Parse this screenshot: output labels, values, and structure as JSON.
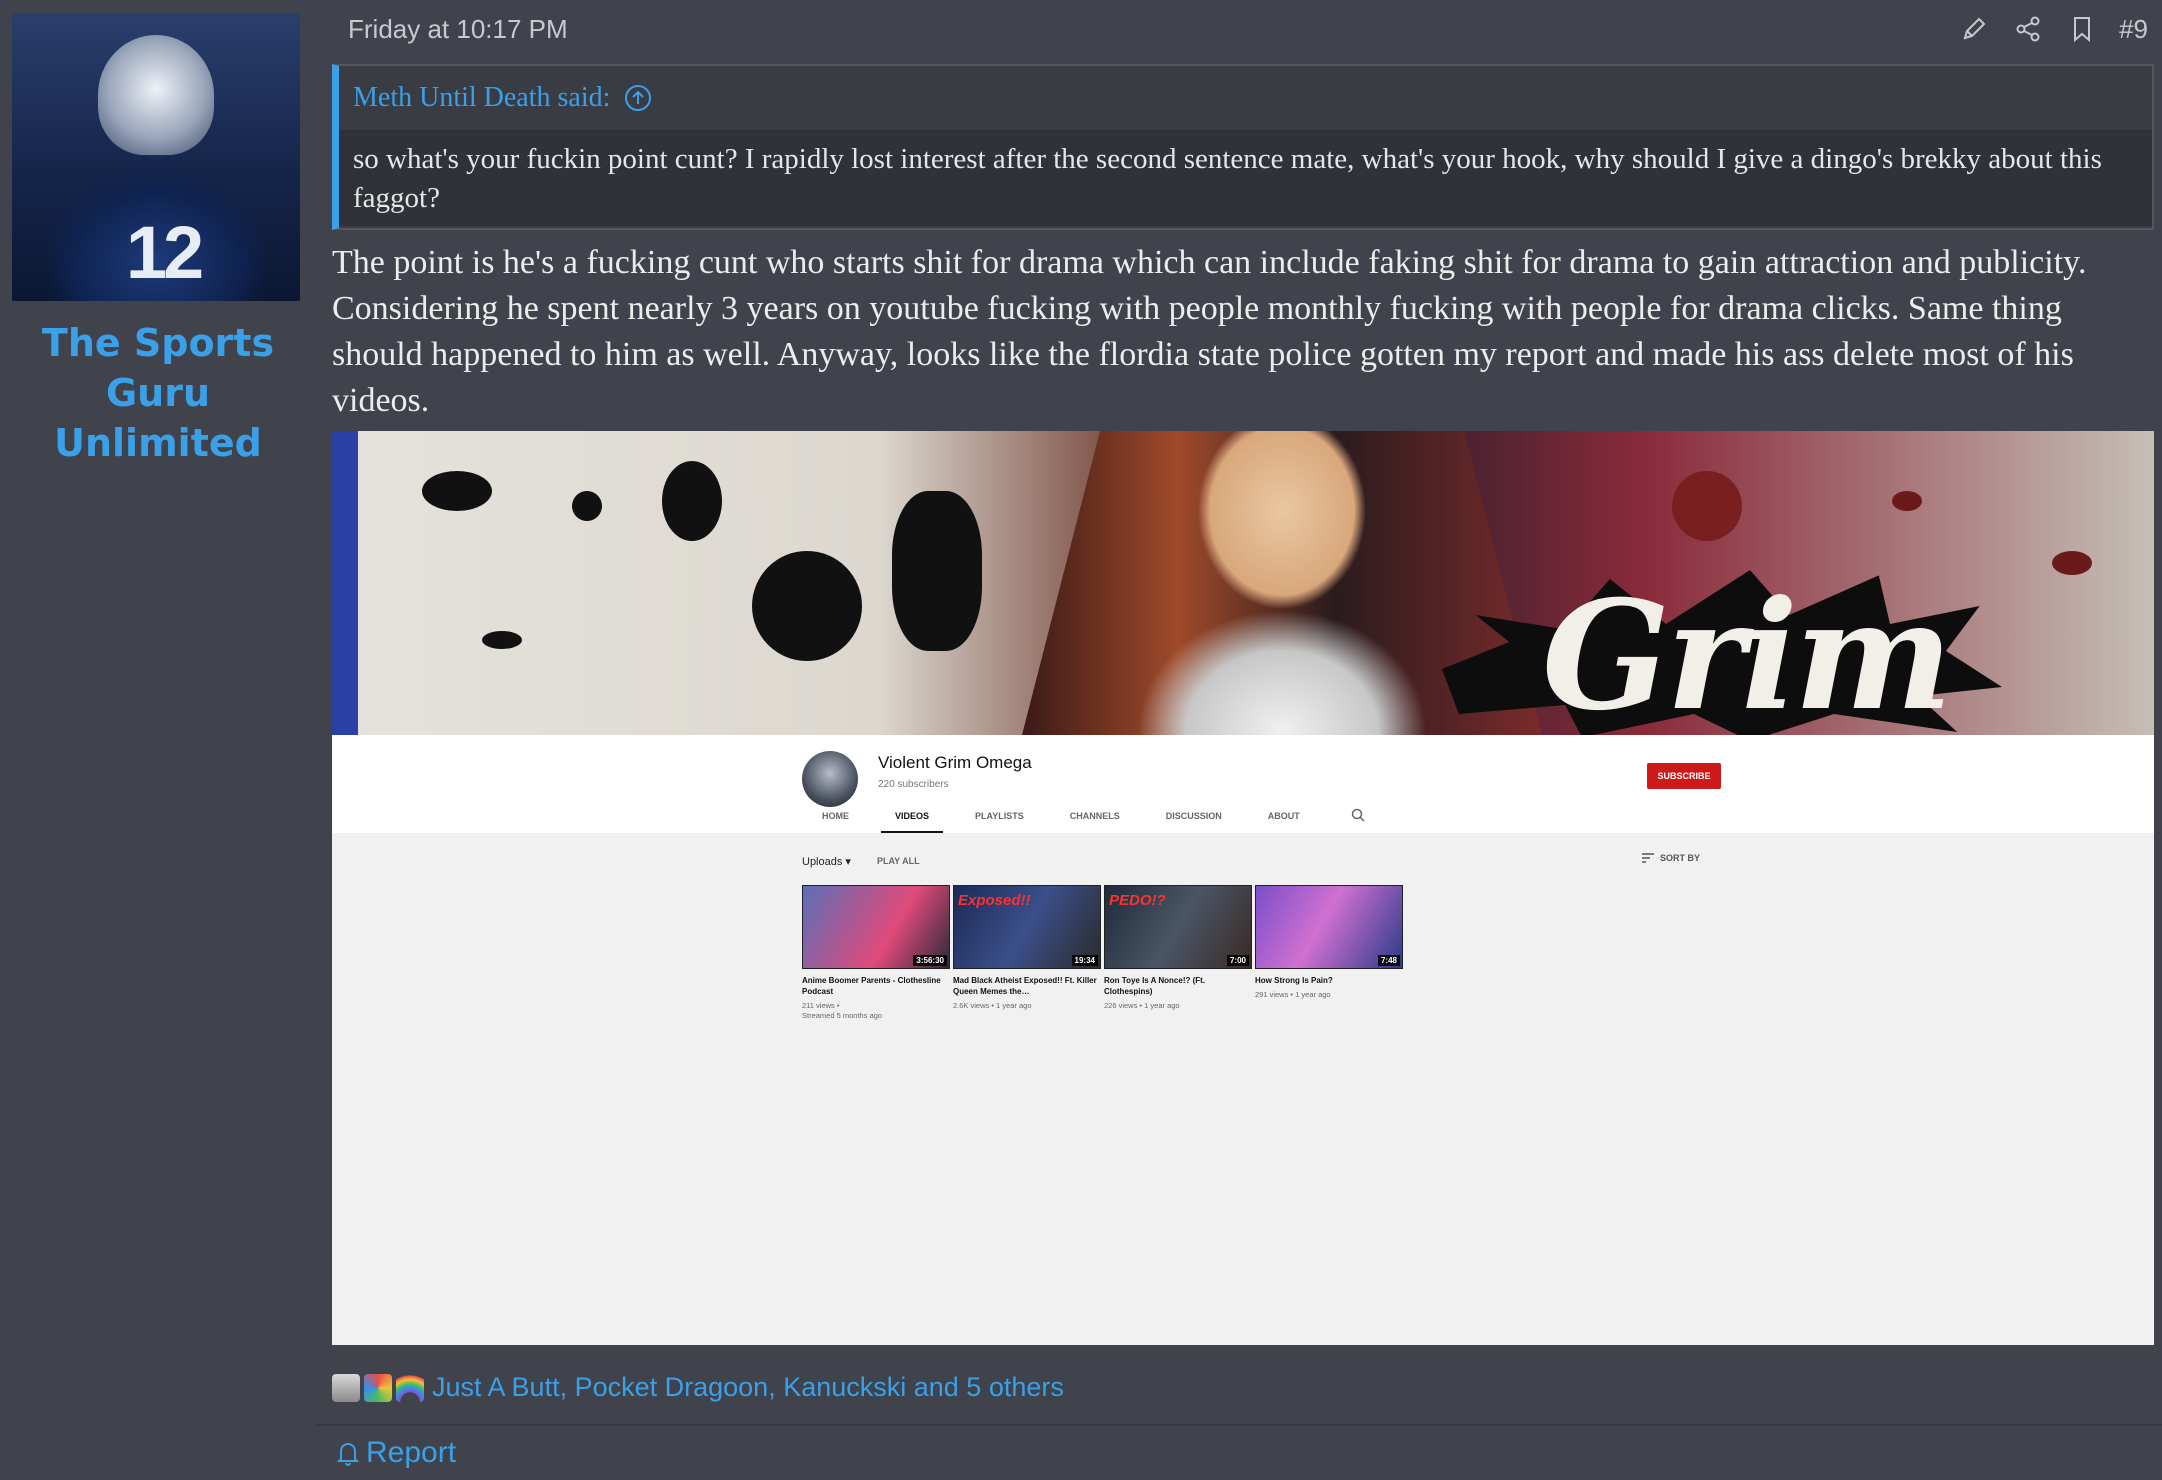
{
  "user": {
    "name": "The Sports Guru Unlimited",
    "avatar_number": "12"
  },
  "post": {
    "date": "Friday at 10:17 PM",
    "number": "#9",
    "actions": [
      "edit-icon",
      "share-icon",
      "bookmark-icon"
    ],
    "quote": {
      "author": "Meth Until Death said:",
      "text": "so what's your fuckin point cunt? I rapidly lost interest after the second sentence mate, what's your hook, why should I give a dingo's brekky about this faggot?"
    },
    "body": "The point is he's a fucking cunt who starts shit for drama which can include faking shit for drama to gain attraction and publicity. Considering he spent nearly 3 years on youtube fucking with people monthly fucking with people for drama clicks. Same thing should happened to him as well. Anyway, looks like the flordia state police gotten my report and made his ass delete most of his videos."
  },
  "embed": {
    "banner_text": "Grim",
    "channel": {
      "name": "Violent Grim Omega",
      "subscribers": "220 subscribers",
      "subscribe_label": "SUBSCRIBE"
    },
    "tabs": [
      "HOME",
      "VIDEOS",
      "PLAYLISTS",
      "CHANNELS",
      "DISCUSSION",
      "ABOUT"
    ],
    "active_tab": "VIDEOS",
    "uploads_label": "Uploads",
    "play_all_label": "PLAY ALL",
    "sort_label": "SORT BY",
    "videos": [
      {
        "title": "Anime Boomer Parents - Clothesline Podcast",
        "meta": "211 views •",
        "meta2": "Streamed 5 months ago",
        "duration": "3:56:30",
        "label": "",
        "colors": [
          "#5b6fb8",
          "#e04a7a"
        ]
      },
      {
        "title": "Mad Black Atheist Exposed!! Ft. Killer Queen Memes the…",
        "meta": "2.6K views • 1 year ago",
        "meta2": "",
        "duration": "19:34",
        "label": "Exposed!!",
        "colors": [
          "#1c2a55",
          "#2b2b2b"
        ]
      },
      {
        "title": "Ron Toye Is A Nonce!? (Ft. Clothespins)",
        "meta": "226 views • 1 year ago",
        "meta2": "",
        "duration": "7:00",
        "label": "PEDO!?",
        "colors": [
          "#1f2a3a",
          "#3a2a24"
        ]
      },
      {
        "title": "How Strong Is Pain?",
        "meta": "291 views • 1 year ago",
        "meta2": "",
        "duration": "7:48",
        "label": "",
        "colors": [
          "#7a4fc9",
          "#2a3b8a"
        ]
      }
    ]
  },
  "reactions": {
    "text": "Just A Butt, Pocket Dragoon, Kanuckski and 5 others",
    "icons": [
      "trophy-icon",
      "puzzle-icon",
      "rainbow-icon"
    ]
  },
  "report_label": "Report",
  "colors": {
    "background": "#40434b",
    "accent": "#3aa0e8",
    "quote_bg": "#393c43",
    "subscribe": "#cc1a1a"
  }
}
